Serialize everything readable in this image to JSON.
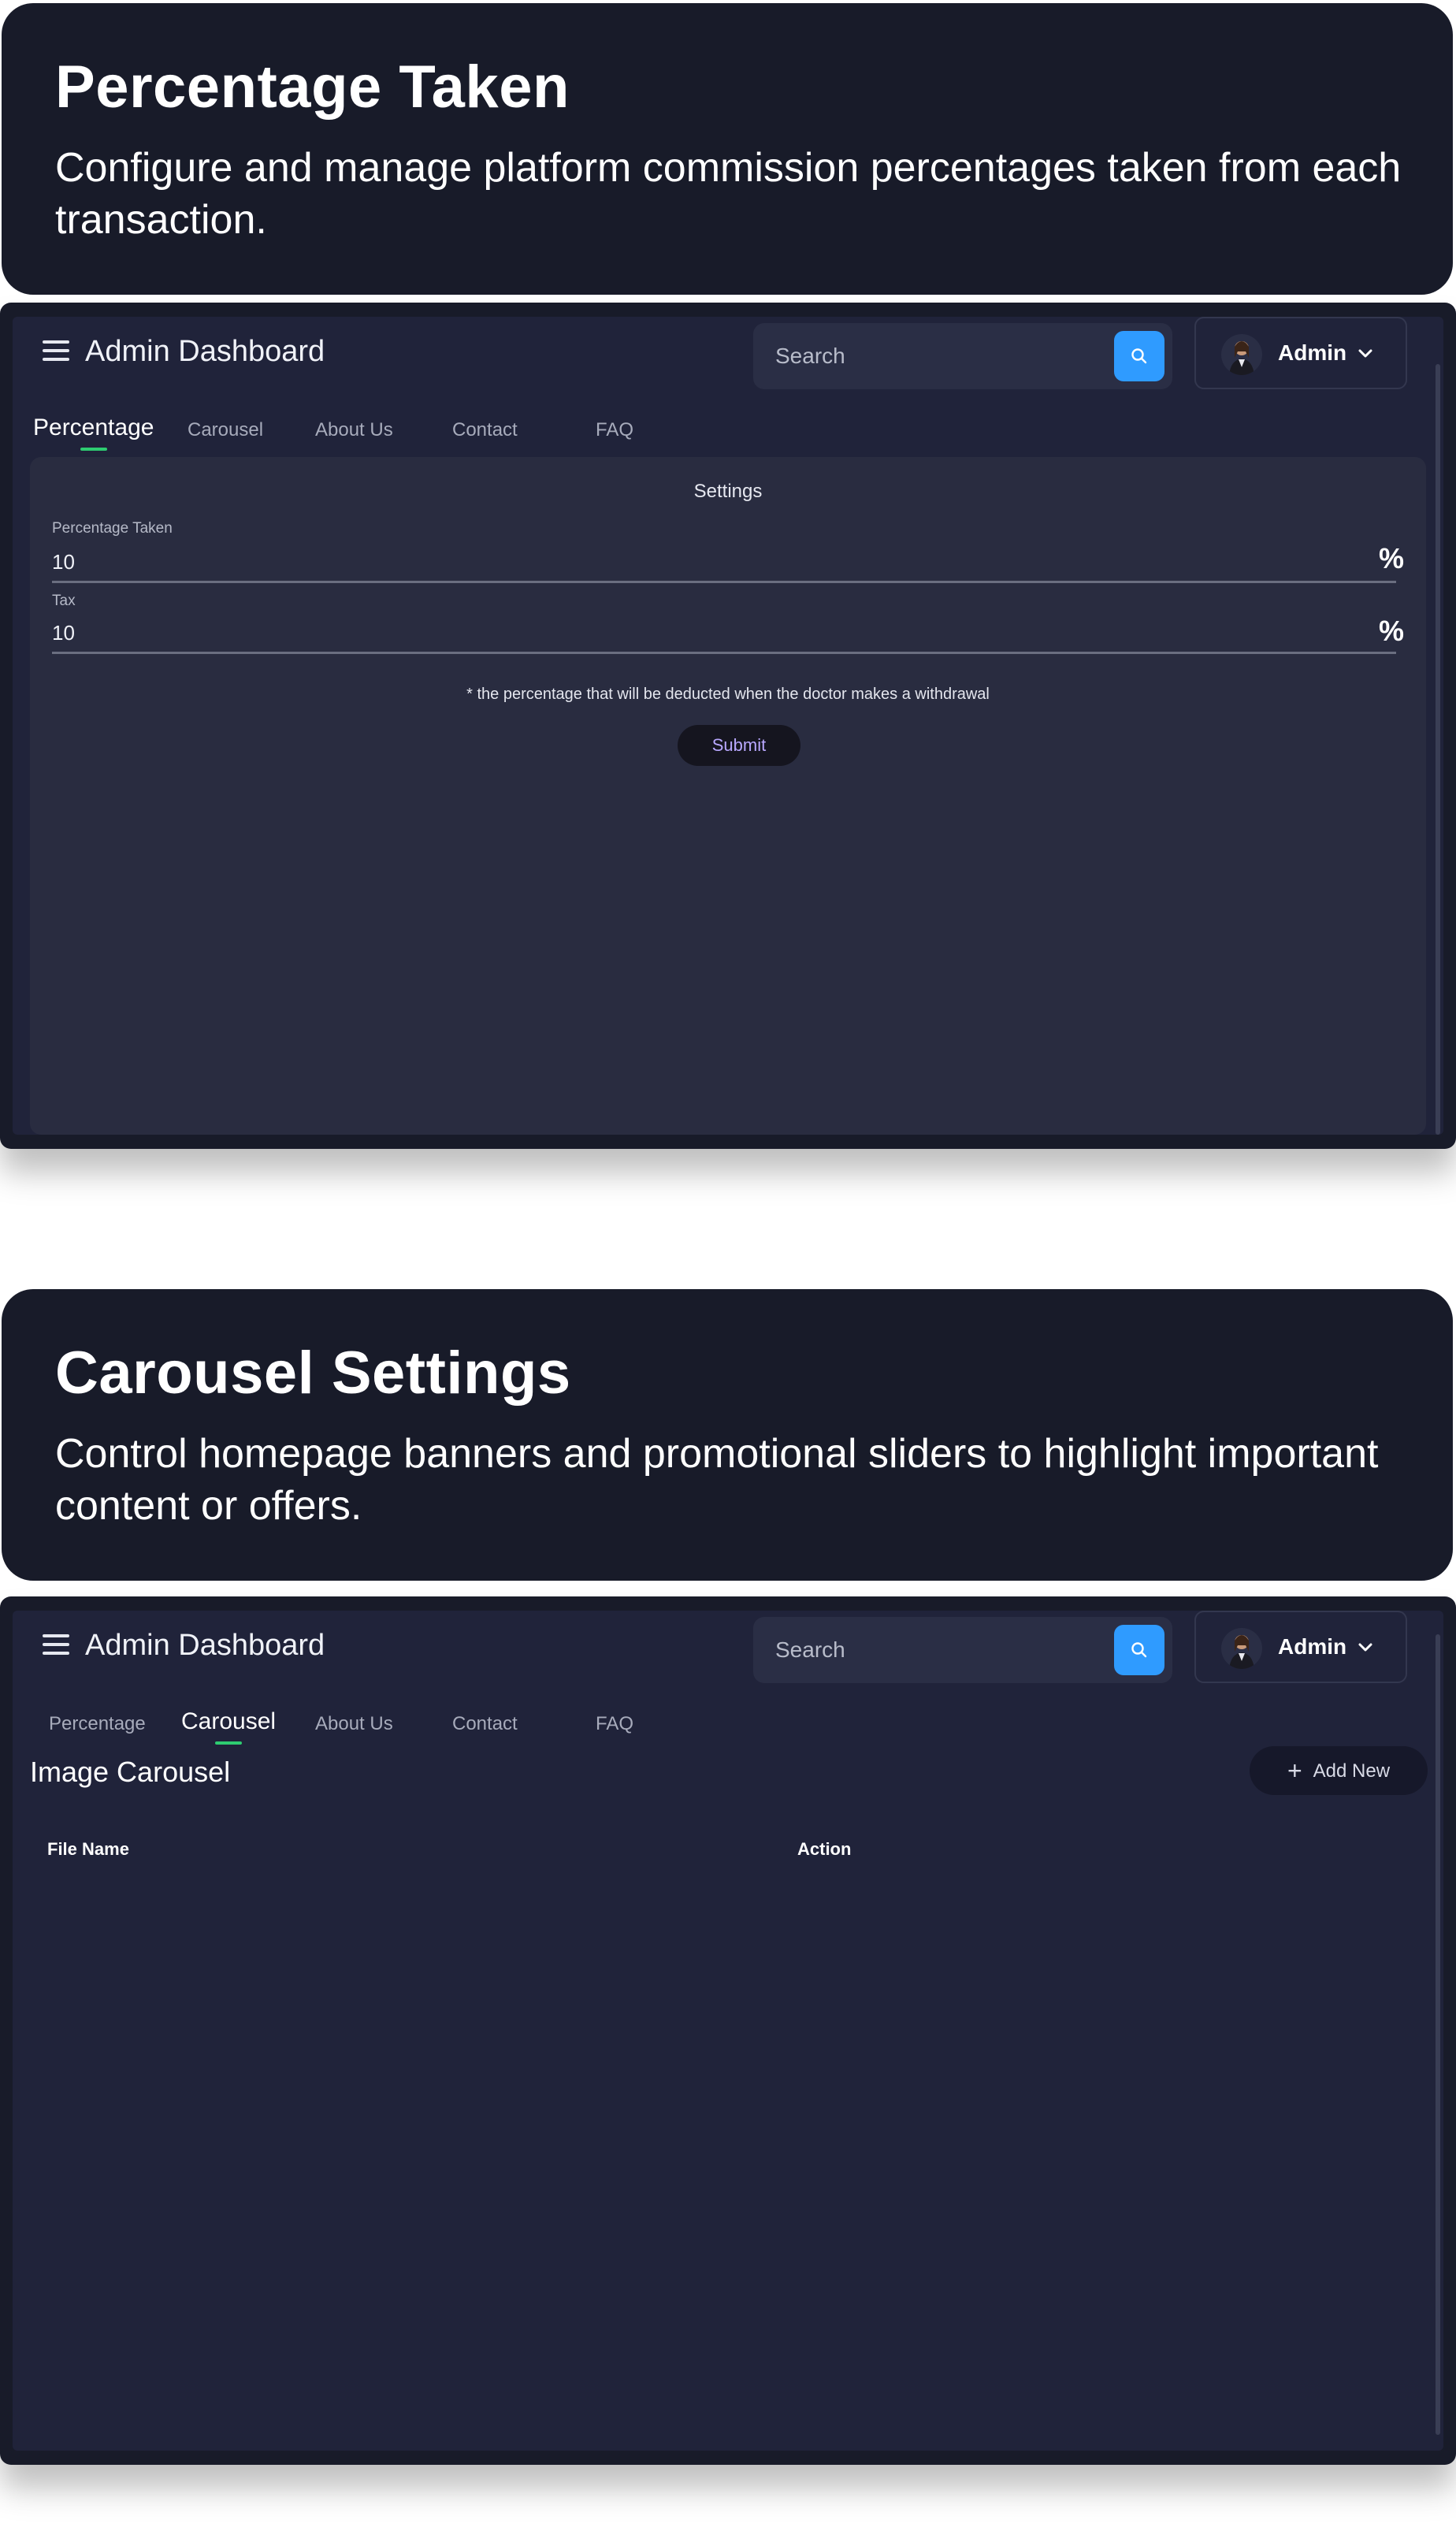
{
  "section1": {
    "title": "Percentage Taken",
    "description": "Configure and manage platform commission percentages taken from each transaction."
  },
  "section2": {
    "title": "Carousel Settings",
    "description": "Control homepage banners and promotional sliders to highlight important content or offers."
  },
  "dashboard": {
    "title": "Admin Dashboard",
    "search_placeholder": "Search",
    "user_name": "Admin",
    "tabs": [
      "Percentage",
      "Carousel",
      "About Us",
      "Contact",
      "FAQ"
    ]
  },
  "percentage_panel": {
    "active_tab": "Percentage",
    "card_title": "Settings",
    "fields": [
      {
        "label": "Percentage Taken",
        "value": "10",
        "suffix": "%"
      },
      {
        "label": "Tax",
        "value": "10",
        "suffix": "%"
      }
    ],
    "note": "* the percentage that will be deducted when the doctor makes a withdrawal",
    "submit_label": "Submit"
  },
  "carousel_panel": {
    "active_tab": "Carousel",
    "heading": "Image Carousel",
    "add_label": "Add New",
    "columns": [
      "File Name",
      "Action"
    ]
  },
  "colors": {
    "page_bg": "#ffffff",
    "hero_bg": "#181b29",
    "panel_bg": "#20233a",
    "card_bg": "#292c40",
    "search_accent": "#2f9bff",
    "active_tab_underline": "#2ecc71",
    "submit_text": "#b9a8ff"
  },
  "icons": [
    "menu-icon",
    "search-icon",
    "avatar",
    "chevron-down-icon",
    "plus-icon"
  ]
}
